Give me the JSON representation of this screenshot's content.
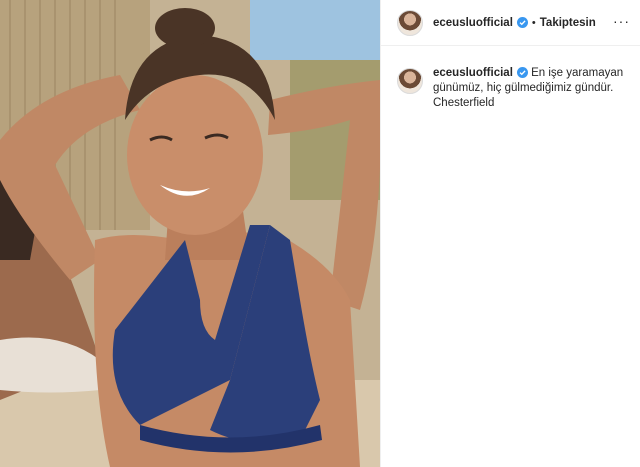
{
  "post": {
    "username": "eceusluofficial",
    "follow_label": "Takiptesin",
    "separator": "•",
    "more_label": "···",
    "caption": {
      "username": "eceusluofficial",
      "text": "En işe yaramayan günümüz, hiç gülmediğimiz gündür. Chesterfield"
    }
  },
  "colors": {
    "verified_blue": "#3897f0",
    "bikini": "#2b3f7a",
    "skin": "#c88d68"
  },
  "icons": {
    "verified": "verified-badge-icon",
    "more": "more-options-icon"
  }
}
